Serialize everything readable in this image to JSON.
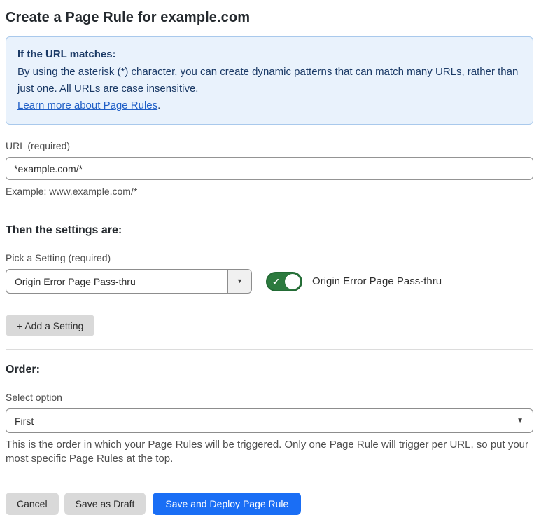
{
  "page": {
    "title": "Create a Page Rule for example.com"
  },
  "info_box": {
    "heading": "If the URL matches:",
    "body": "By using the asterisk (*) character, you can create dynamic patterns that can match many URLs, rather than just one. All URLs are case insensitive.",
    "link_label": "Learn more about Page Rules",
    "link_suffix": "."
  },
  "url_field": {
    "label": "URL (required)",
    "value": "*example.com/*",
    "example": "Example: www.example.com/*"
  },
  "settings_section": {
    "heading": "Then the settings are:",
    "picker_label": "Pick a Setting (required)",
    "picker_value": "Origin Error Page Pass-thru",
    "dropdown_arrow_icon": "▼",
    "toggle": {
      "state": "on",
      "check_icon": "✓",
      "label": "Origin Error Page Pass-thru"
    },
    "add_setting_label": "+ Add a Setting"
  },
  "order_section": {
    "heading": "Order:",
    "select_label": "Select option",
    "select_value": "First",
    "select_arrow_icon": "▼",
    "help_text": "This is the order in which your Page Rules will be triggered. Only one Page Rule will trigger per URL, so put your most specific Page Rules at the top."
  },
  "footer": {
    "cancel_label": "Cancel",
    "save_draft_label": "Save as Draft",
    "save_deploy_label": "Save and Deploy Page Rule"
  },
  "colors": {
    "accent_blue": "#1a6ef5",
    "link_blue": "#2160c7",
    "info_bg": "#e9f2fc",
    "info_border": "#a9c9ec",
    "info_text": "#1b3a66",
    "toggle_green": "#2c7a3e",
    "toggle_green_border": "#236b35",
    "btn_gray": "#d9d9d9",
    "divider": "#dcdcdc"
  }
}
